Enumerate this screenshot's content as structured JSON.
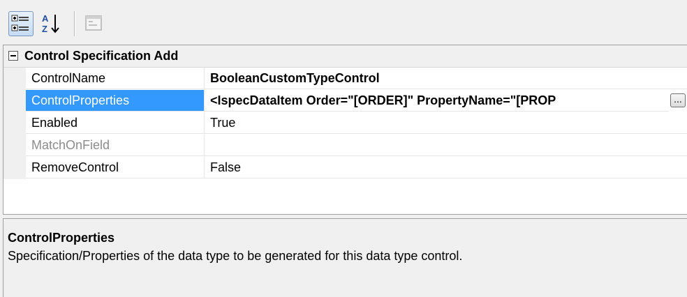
{
  "toolbar": {
    "categorized_icon": "categorized-icon",
    "alphabetical_icon": "alphabetical-sort-icon",
    "property_pages_icon": "property-pages-icon"
  },
  "grid": {
    "category": {
      "label": "Control Specification Add",
      "expanded": true
    },
    "properties": [
      {
        "name": "ControlName",
        "value": "BooleanCustomTypeControl",
        "bold": true
      },
      {
        "name": "ControlProperties",
        "value": "<IspecDataItem Order=\"[ORDER]\" PropertyName=\"[PROP",
        "bold": true,
        "selected": true,
        "ellipsis": "..."
      },
      {
        "name": "Enabled",
        "value": "True"
      },
      {
        "name": "MatchOnField",
        "value": "",
        "disabled": true
      },
      {
        "name": "RemoveControl",
        "value": "False"
      }
    ]
  },
  "description": {
    "title": "ControlProperties",
    "text": "Specification/Properties of the data type to be generated for this data type control."
  },
  "colors": {
    "selection": "#3399ff",
    "background": "#f0f0f0",
    "grid_background": "#ffffff"
  }
}
